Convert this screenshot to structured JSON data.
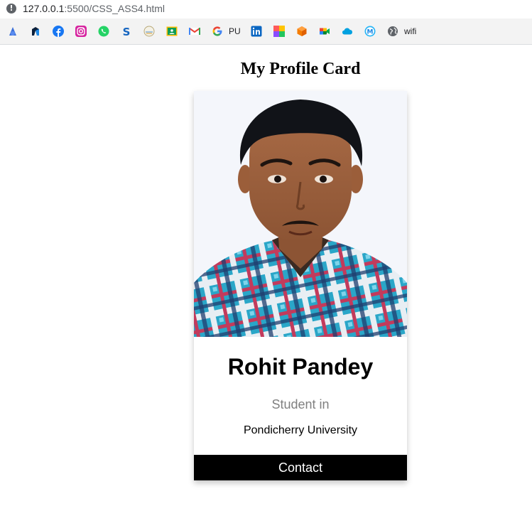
{
  "browser": {
    "url_host": "127.0.0.1",
    "url_path": ":5500/CSS_ASS4.html",
    "bookmarks": {
      "pu_label": "PU",
      "wifi_label": "wifi"
    },
    "bookmark_icons": [
      "browser-logo-icon",
      "sharp-icon",
      "facebook-icon",
      "instagram-icon",
      "whatsapp-icon",
      "s-letter-icon",
      "emblem-icon",
      "classroom-icon",
      "gmail-icon",
      "google-icon",
      "linkedin-icon",
      "colorful-grid-icon",
      "cube-icon",
      "meet-icon",
      "cloud-icon",
      "m-circle-icon",
      "globe-icon"
    ]
  },
  "page": {
    "heading": "My Profile Card"
  },
  "card": {
    "name": "Rohit Pandey",
    "title": "Student in",
    "university": "Pondicherry University",
    "contact_label": "Contact"
  },
  "colors": {
    "button_bg": "#000000",
    "title_gray": "#808080",
    "facebook": "#1877f2",
    "whatsapp": "#25d366"
  }
}
